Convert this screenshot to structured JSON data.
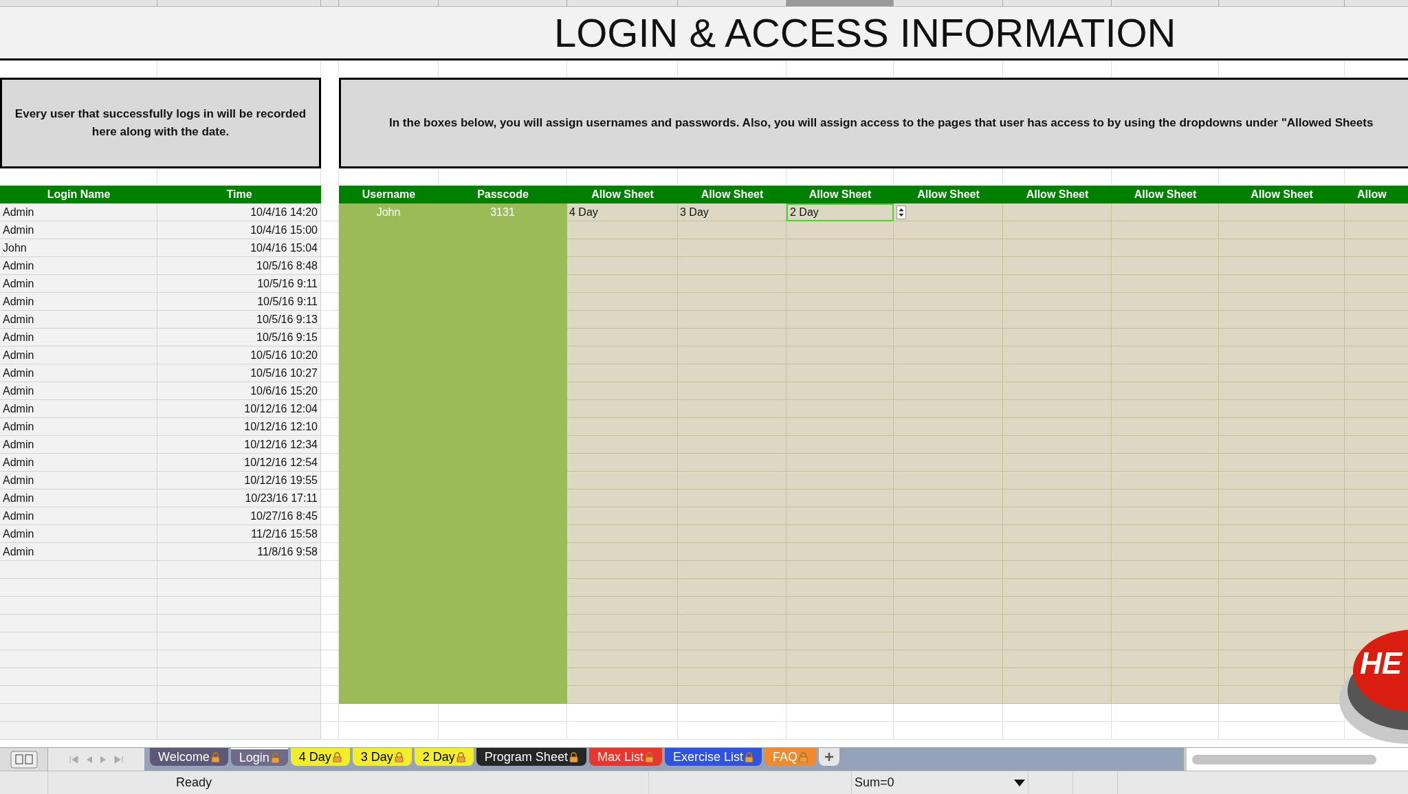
{
  "title": "LOGIN & ACCESS INFORMATION",
  "login_note": "Every user that successfully logs in will be recorded here along with the date.",
  "access_note": "In the boxes below, you will assign usernames and passwords.  Also, you will assign access to the pages that user has access to by using the dropdowns under \"Allowed Sheets",
  "login_table": {
    "columns": [
      "Login Name",
      "Time"
    ],
    "rows": [
      {
        "name": "Admin",
        "time": "10/4/16 14:20"
      },
      {
        "name": "Admin",
        "time": "10/4/16 15:00"
      },
      {
        "name": "John",
        "time": "10/4/16 15:04"
      },
      {
        "name": "Admin",
        "time": "10/5/16 8:48"
      },
      {
        "name": "Admin",
        "time": "10/5/16 9:11"
      },
      {
        "name": "Admin",
        "time": "10/5/16 9:11"
      },
      {
        "name": "Admin",
        "time": "10/5/16 9:13"
      },
      {
        "name": "Admin",
        "time": "10/5/16 9:15"
      },
      {
        "name": "Admin",
        "time": "10/5/16 10:20"
      },
      {
        "name": "Admin",
        "time": "10/5/16 10:27"
      },
      {
        "name": "Admin",
        "time": "10/6/16 15:20"
      },
      {
        "name": "Admin",
        "time": "10/12/16 12:04"
      },
      {
        "name": "Admin",
        "time": "10/12/16 12:10"
      },
      {
        "name": "Admin",
        "time": "10/12/16 12:34"
      },
      {
        "name": "Admin",
        "time": "10/12/16 12:54"
      },
      {
        "name": "Admin",
        "time": "10/12/16 19:55"
      },
      {
        "name": "Admin",
        "time": "10/23/16 17:11"
      },
      {
        "name": "Admin",
        "time": "10/27/16 8:45"
      },
      {
        "name": "Admin",
        "time": "11/2/16 15:58"
      },
      {
        "name": "Admin",
        "time": "11/8/16 9:58"
      }
    ]
  },
  "access_table": {
    "columns": [
      "Username",
      "Passcode",
      "Allow Sheet",
      "Allow Sheet",
      "Allow Sheet",
      "Allow Sheet",
      "Allow Sheet",
      "Allow Sheet",
      "Allow Sheet",
      "Allow"
    ],
    "rows": [
      {
        "username": "John",
        "passcode": "3131",
        "sheets": [
          {
            "value": "4 Day",
            "selected": false
          },
          {
            "value": "3 Day",
            "selected": false
          },
          {
            "value": "2 Day",
            "selected": true
          }
        ]
      }
    ]
  },
  "help_button": {
    "label": "HE"
  },
  "sheet_tabs": [
    {
      "label": "Welcome",
      "color": "#5e5878",
      "selected": false,
      "locked": true
    },
    {
      "label": "Login",
      "color": "#6e6a88",
      "selected": true,
      "locked": true
    },
    {
      "label": "4 Day",
      "color": "#f2ee2e",
      "selected": false,
      "locked": true
    },
    {
      "label": "3 Day",
      "color": "#f2ee2e",
      "selected": false,
      "locked": true
    },
    {
      "label": "2 Day",
      "color": "#f2ee2e",
      "selected": false,
      "locked": true
    },
    {
      "label": "Program Sheet",
      "color": "#262626",
      "selected": false,
      "locked": true
    },
    {
      "label": "Max List",
      "color": "#e8362e",
      "selected": false,
      "locked": true
    },
    {
      "label": "Exercise List",
      "color": "#2f52e0",
      "selected": false,
      "locked": true
    },
    {
      "label": "FAQ",
      "color": "#f08a30",
      "selected": false,
      "locked": true
    }
  ],
  "status_bar": {
    "mode": "Ready",
    "sum": "Sum=0"
  }
}
